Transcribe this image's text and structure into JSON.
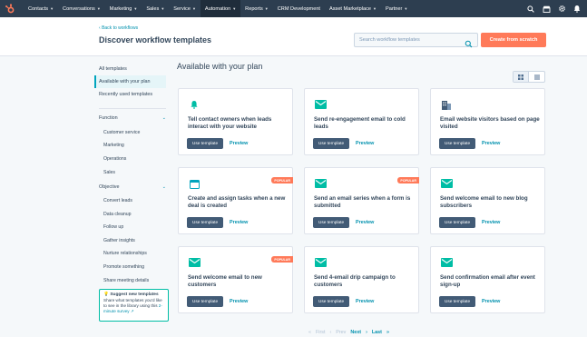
{
  "topnav": {
    "items": [
      {
        "label": "Contacts",
        "has_menu": true
      },
      {
        "label": "Conversations",
        "has_menu": true
      },
      {
        "label": "Marketing",
        "has_menu": true
      },
      {
        "label": "Sales",
        "has_menu": true
      },
      {
        "label": "Service",
        "has_menu": true
      },
      {
        "label": "Automation",
        "has_menu": true,
        "active": true
      },
      {
        "label": "Reports",
        "has_menu": true
      },
      {
        "label": "CRM Development",
        "has_menu": false
      },
      {
        "label": "Asset Marketplace",
        "has_menu": true
      },
      {
        "label": "Partner",
        "has_menu": true
      }
    ],
    "right_icons": [
      "search-icon",
      "marketplace-icon",
      "settings-icon",
      "notifications-icon"
    ]
  },
  "header": {
    "back_link": "Back to workflows",
    "title": "Discover workflow templates",
    "search_placeholder": "Search workflow templates",
    "create_button": "Create from scratch"
  },
  "sidebar": {
    "links": [
      "All templates",
      "Available with your plan",
      "Recently used templates"
    ],
    "active_index": 1,
    "function_label": "Function",
    "function_items": [
      "Customer service",
      "Marketing",
      "Operations",
      "Sales"
    ],
    "objective_label": "Objective",
    "objective_items": [
      "Convert leads",
      "Data cleanup",
      "Follow up",
      "Gather insights",
      "Nurture relationships",
      "Promote something",
      "Share meeting details"
    ],
    "suggest": {
      "title": "Suggest new templates",
      "body": "Share what templates you'd like to see in the library using this",
      "link": "2-minute survey"
    }
  },
  "main": {
    "title": "Available with your plan",
    "use_label": "Use template",
    "preview_label": "Preview",
    "popular_label": "POPULAR",
    "cards": [
      {
        "title": "Tell contact owners when leads interact with your website",
        "icon": "bell-icon",
        "popular": false
      },
      {
        "title": "Send re-engagement email to cold leads",
        "icon": "email-icon",
        "popular": false
      },
      {
        "title": "Email website visitors based on page visited",
        "icon": "building-icon",
        "popular": false
      },
      {
        "title": "Create and assign tasks when a new deal is created",
        "icon": "calendar-icon",
        "popular": true
      },
      {
        "title": "Send an email series when a form is submitted",
        "icon": "email-icon",
        "popular": true
      },
      {
        "title": "Send welcome email to new blog subscribers",
        "icon": "email-icon",
        "popular": false
      },
      {
        "title": "Send welcome email to new customers",
        "icon": "email-icon",
        "popular": true
      },
      {
        "title": "Send 4-email drip campaign to customers",
        "icon": "email-icon",
        "popular": false
      },
      {
        "title": "Send confirmation email after event sign-up",
        "icon": "email-icon",
        "popular": false
      }
    ]
  },
  "pagination": {
    "first": "First",
    "prev": "Prev",
    "next": "Next",
    "last": "Last"
  },
  "colors": {
    "nav_bg": "#2d3e50",
    "accent": "#ff7a59",
    "link": "#0091ae",
    "teal": "#00bda5",
    "button": "#425b76"
  }
}
